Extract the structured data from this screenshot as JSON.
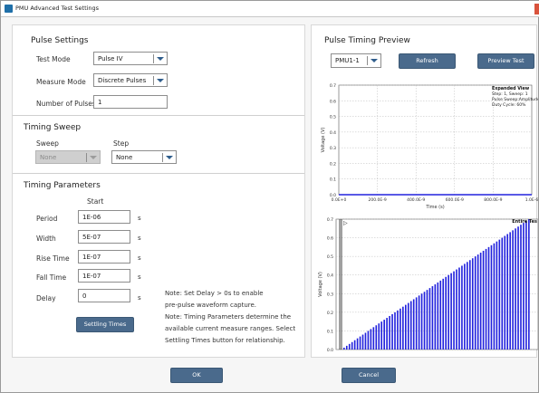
{
  "window": {
    "title": "PMU Advanced Test Settings"
  },
  "pulse_settings": {
    "heading": "Pulse Settings",
    "test_mode_label": "Test Mode",
    "test_mode_value": "Pulse IV",
    "measure_mode_label": "Measure Mode",
    "measure_mode_value": "Discrete Pulses",
    "num_pulses_label": "Number of Pulses",
    "num_pulses_value": "1"
  },
  "timing_sweep": {
    "heading": "Timing Sweep",
    "sweep_label": "Sweep",
    "sweep_value": "None",
    "step_label": "Step",
    "step_value": "None"
  },
  "timing_parameters": {
    "heading": "Timing Parameters",
    "start_col": "Start",
    "rows": [
      {
        "label": "Period",
        "value": "1E-06",
        "unit": "s"
      },
      {
        "label": "Width",
        "value": "5E-07",
        "unit": "s"
      },
      {
        "label": "Rise Time",
        "value": "1E-07",
        "unit": "s"
      },
      {
        "label": "Fall Time",
        "value": "1E-07",
        "unit": "s"
      },
      {
        "label": "Delay",
        "value": "0",
        "unit": "s"
      }
    ],
    "settling_btn": "Settling Times",
    "notes": [
      "Note: Set Delay > 0s to enable",
      "pre-pulse waveform capture.",
      "Note: Timing Parameters determine the",
      "available current measure ranges. Select",
      "Settling Times button for relationship."
    ]
  },
  "preview": {
    "heading": "Pulse Timing Preview",
    "channel_value": "PMU1-1",
    "refresh_btn": "Refresh",
    "preview_btn": "Preview Test"
  },
  "footer": {
    "ok": "OK",
    "cancel": "Cancel"
  },
  "colors": {
    "accent": "#4a6a8c",
    "trace": "#2222dd"
  },
  "chart_data": [
    {
      "type": "line",
      "title": "",
      "xlabel": "Time (s)",
      "ylabel": "Voltage (V)",
      "x_tick_labels": [
        "0.0E+0",
        "200.0E-9",
        "400.0E-9",
        "600.0E-9",
        "800.0E-9",
        "1.0E-6"
      ],
      "y_tick_labels": [
        "0.0",
        "0.1",
        "0.2",
        "0.3",
        "0.4",
        "0.5",
        "0.6",
        "0.7"
      ],
      "xlim": [
        0,
        1e-06
      ],
      "ylim": [
        0,
        0.7
      ],
      "grid": true,
      "series": [
        {
          "x": [
            0,
            1e-06
          ],
          "values": [
            0,
            0
          ]
        }
      ],
      "annotation": {
        "title": "Expanded View",
        "lines": [
          "Step: 1, Sweep: 1",
          "Pulse Sweep:Amplitude",
          "Duty Cycle: 60%"
        ]
      }
    },
    {
      "type": "bar",
      "title": "",
      "ylabel": "Voltage (V)",
      "y_tick_labels": [
        "0.0",
        "0.1",
        "0.2",
        "0.3",
        "0.4",
        "0.5",
        "0.6",
        "0.7"
      ],
      "ylim": [
        0,
        0.7
      ],
      "grid": true,
      "annotation": "Entire Tes",
      "pulse_count": 70,
      "amplitude_start": 0.01,
      "amplitude_end": 0.7
    }
  ]
}
